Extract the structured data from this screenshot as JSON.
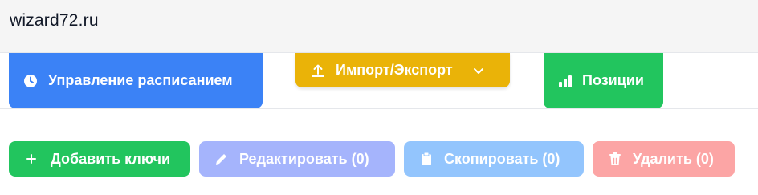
{
  "header": {
    "site": "wizard72.ru"
  },
  "toolbar": {
    "schedule": {
      "label": "Управление расписанием",
      "icon": "clock-icon",
      "color": "#3b82f6"
    },
    "import_export": {
      "label": "Импорт/Экспорт",
      "icon": "upload-icon",
      "dropdown_icon": "chevron-down-icon",
      "color": "#eab308"
    },
    "positions": {
      "label": "Позиции",
      "icon": "bar-chart-icon",
      "color": "#22c55e"
    }
  },
  "actions": {
    "add": {
      "label": "Добавить ключи",
      "icon": "plus-icon",
      "color": "#22c55e"
    },
    "edit": {
      "label": "Редактировать (0)",
      "icon": "pencil-icon",
      "color": "#a5b4fc"
    },
    "copy": {
      "label": "Скопировать (0)",
      "icon": "clipboard-icon",
      "color": "#93c5fd"
    },
    "delete": {
      "label": "Удалить (0)",
      "icon": "trash-icon",
      "color": "#fca5a5"
    }
  }
}
